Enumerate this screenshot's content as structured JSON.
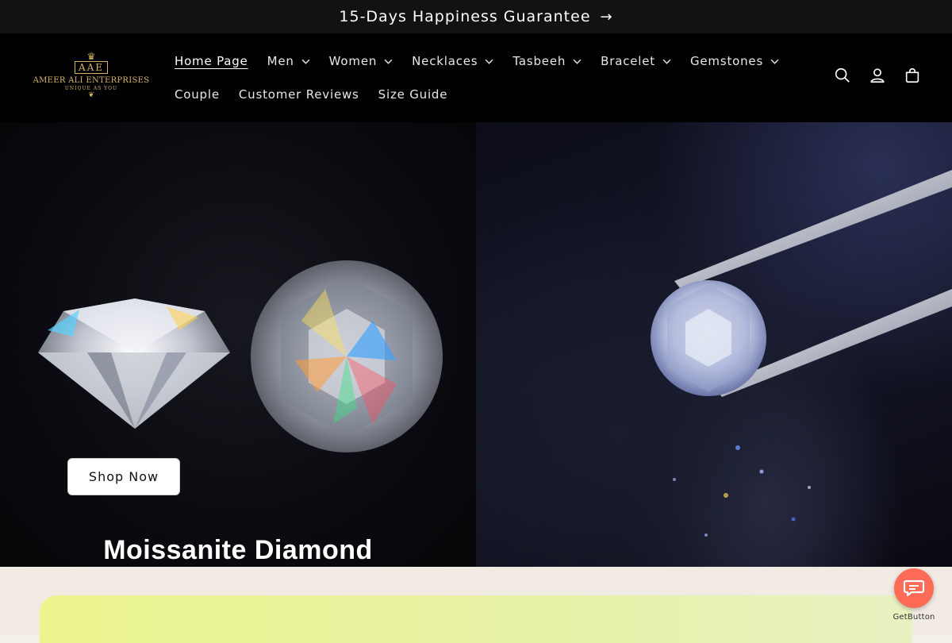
{
  "announcement": {
    "text": "15-Days Happiness Guarantee",
    "arrow": "→"
  },
  "logo": {
    "monogram": "AAE",
    "brand": "AMEER ALI ENTERPRISES",
    "tagline": "UNIQUE AS YOU"
  },
  "nav": {
    "row1": [
      {
        "label": "Home Page",
        "active": true,
        "dropdown": false
      },
      {
        "label": "Men",
        "dropdown": true
      },
      {
        "label": "Women",
        "dropdown": true
      },
      {
        "label": "Necklaces",
        "dropdown": true
      },
      {
        "label": "Tasbeeh",
        "dropdown": true
      },
      {
        "label": "Bracelet",
        "dropdown": true
      },
      {
        "label": "Gemstones",
        "dropdown": true
      }
    ],
    "row2": [
      {
        "label": "Couple"
      },
      {
        "label": "Customer Reviews"
      },
      {
        "label": "Size Guide"
      }
    ]
  },
  "header_icons": [
    "search-icon",
    "account-icon",
    "cart-icon"
  ],
  "hero": {
    "title": "Moissanite Diamond",
    "button_label": "Shop Now"
  },
  "widgets": {
    "getbutton_label": "GetButton"
  },
  "colors": {
    "announcement_bg": "#121212",
    "header_bg": "#000000",
    "logo_gold": "#d4b56a",
    "section_bg": "#f1ebe3",
    "promo_green": "#ecf58e",
    "chat_button": "#ff6b57"
  }
}
